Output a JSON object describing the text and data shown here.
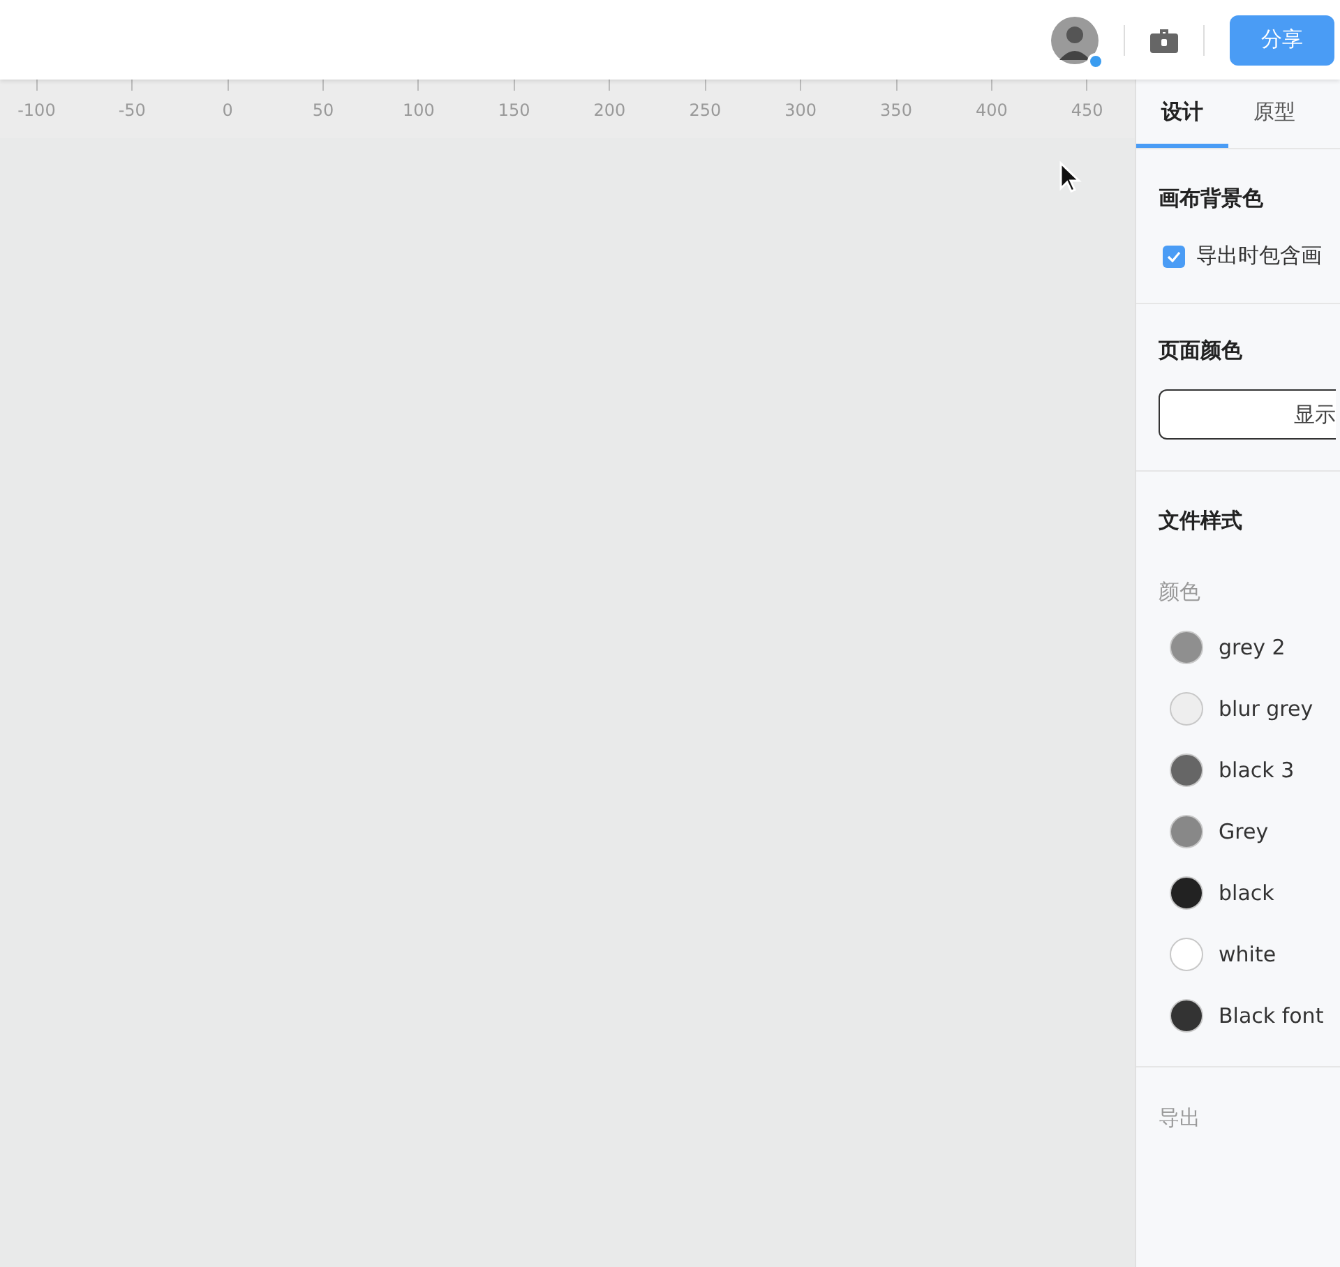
{
  "top_bar": {
    "share_button": "分享"
  },
  "ruler": {
    "labels": [
      "-100",
      "-50",
      "0",
      "50",
      "100",
      "150",
      "200",
      "250",
      "300",
      "350",
      "400",
      "450"
    ]
  },
  "panel": {
    "tabs": [
      {
        "label": "设计",
        "selected": true
      },
      {
        "label": "原型",
        "selected": false
      }
    ],
    "canvas_background": {
      "title": "画布背景色",
      "checkbox": {
        "label": "导出时包含画",
        "checked": true
      }
    },
    "page_color": {
      "title": "页面颜色",
      "button": "显示"
    },
    "file_styles": {
      "title": "文件样式",
      "subtitle": "颜色",
      "colors": [
        {
          "name": "grey 2",
          "color": "#8f8f8f"
        },
        {
          "name": "blur grey",
          "color": "#eeeeee"
        },
        {
          "name": "black 3",
          "color": "#666666"
        },
        {
          "name": "Grey",
          "color": "#888888"
        },
        {
          "name": "black",
          "color": "#222222"
        },
        {
          "name": "white",
          "color": "#ffffff"
        },
        {
          "name": "Black font",
          "color": "#333333"
        }
      ]
    },
    "export": {
      "title": "导出"
    }
  }
}
